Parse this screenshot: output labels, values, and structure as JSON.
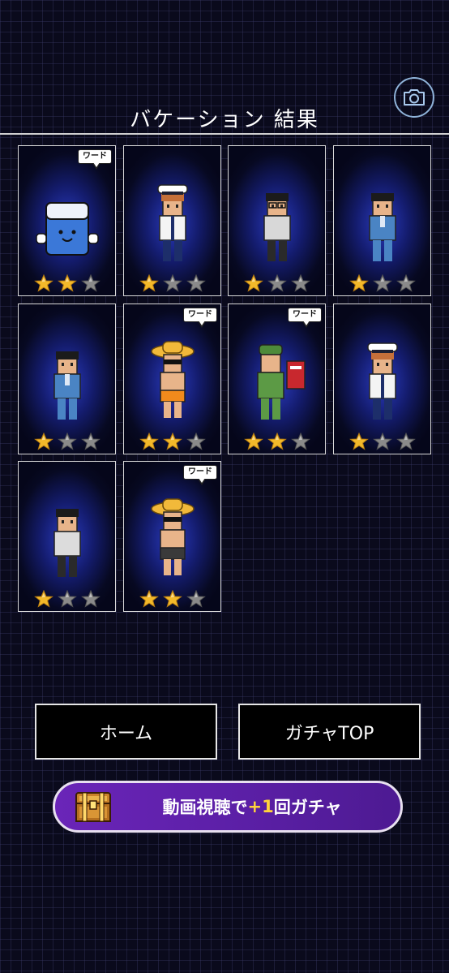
{
  "header": {
    "title": "バケーション 結果"
  },
  "icons": {
    "camera": "camera-icon",
    "chest": "treasure-chest-icon"
  },
  "colors": {
    "star_filled": "#f3b92a",
    "star_empty": "#8a8a8a",
    "accent_plus": "#ffd33a",
    "video_button": "#5b1fa6"
  },
  "results": [
    {
      "character": "eraser-mascot",
      "stars": 2,
      "max_stars": 3,
      "badge": "ワード"
    },
    {
      "character": "captain",
      "stars": 1,
      "max_stars": 3,
      "badge": ""
    },
    {
      "character": "man-with-glasses",
      "stars": 1,
      "max_stars": 3,
      "badge": ""
    },
    {
      "character": "man-in-blue-suit",
      "stars": 1,
      "max_stars": 3,
      "badge": ""
    },
    {
      "character": "man-in-blue-suit",
      "stars": 1,
      "max_stars": 3,
      "badge": ""
    },
    {
      "character": "straw-hat-sunglasses",
      "stars": 2,
      "max_stars": 3,
      "badge": "ワード"
    },
    {
      "character": "green-soldier-with-mailbox",
      "stars": 2,
      "max_stars": 3,
      "badge": "ワード"
    },
    {
      "character": "captain",
      "stars": 1,
      "max_stars": 3,
      "badge": ""
    },
    {
      "character": "man-in-white-shirt",
      "stars": 1,
      "max_stars": 3,
      "badge": ""
    },
    {
      "character": "straw-hat-sunglasses-dark",
      "stars": 2,
      "max_stars": 3,
      "badge": "ワード"
    }
  ],
  "buttons": {
    "home": "ホーム",
    "gacha_top": "ガチャTOP",
    "video_prefix": "動画視聴で",
    "video_plus": "+1",
    "video_suffix": "回ガチャ"
  }
}
